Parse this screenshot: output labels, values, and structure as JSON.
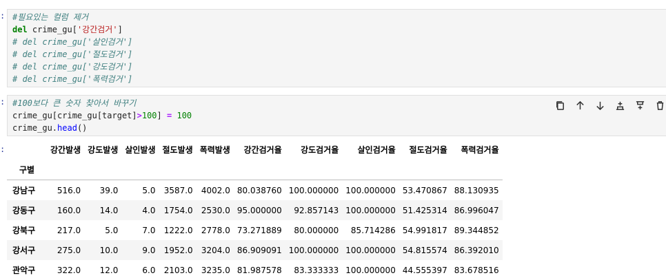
{
  "cell1": {
    "lines": [
      [
        {
          "t": "#필요있는 컬럼 제거",
          "c": "cm"
        }
      ],
      [
        {
          "t": "del",
          "c": "kw"
        },
        {
          "t": " crime_gu[",
          "c": ""
        },
        {
          "t": "'강간검거'",
          "c": "st"
        },
        {
          "t": "]",
          "c": ""
        }
      ],
      [
        {
          "t": "# del crime_gu['살인검거']",
          "c": "cm"
        }
      ],
      [
        {
          "t": "# del crime_gu['절도검거']",
          "c": "cm"
        }
      ],
      [
        {
          "t": "# del crime_gu['강도검거']",
          "c": "cm"
        }
      ],
      [
        {
          "t": "# del crime_gu['폭력검거']",
          "c": "cm"
        }
      ]
    ]
  },
  "cell2": {
    "lines": [
      [
        {
          "t": "#100보다 큰 숫자 찾아서 바꾸기",
          "c": "cm"
        }
      ],
      [
        {
          "t": "crime_gu[crime_gu[target]",
          "c": ""
        },
        {
          "t": ">",
          "c": "op"
        },
        {
          "t": "100",
          "c": "nu"
        },
        {
          "t": "] ",
          "c": ""
        },
        {
          "t": "=",
          "c": "op"
        },
        {
          "t": " ",
          "c": ""
        },
        {
          "t": "100",
          "c": "nu"
        }
      ],
      [
        {
          "t": "crime_gu.",
          "c": ""
        },
        {
          "t": "head",
          "c": "fn"
        },
        {
          "t": "()",
          "c": ""
        }
      ]
    ],
    "toolbar": [
      "copy-icon",
      "move-up-icon",
      "move-down-icon",
      "insert-above-icon",
      "insert-below-icon",
      "delete-icon"
    ]
  },
  "table": {
    "index_name": "구별",
    "columns": [
      "강간발생",
      "강도발생",
      "살인발생",
      "절도발생",
      "폭력발생",
      "강간검거율",
      "강도검거율",
      "살인검거율",
      "절도검거율",
      "폭력검거율"
    ],
    "rows": [
      {
        "index": "강남구",
        "values": [
          "516.0",
          "39.0",
          "5.0",
          "3587.0",
          "4002.0",
          "80.038760",
          "100.000000",
          "100.000000",
          "53.470867",
          "88.130935"
        ]
      },
      {
        "index": "강동구",
        "values": [
          "160.0",
          "14.0",
          "4.0",
          "1754.0",
          "2530.0",
          "95.000000",
          "92.857143",
          "100.000000",
          "51.425314",
          "86.996047"
        ]
      },
      {
        "index": "강북구",
        "values": [
          "217.0",
          "5.0",
          "7.0",
          "1222.0",
          "2778.0",
          "73.271889",
          "80.000000",
          "85.714286",
          "54.991817",
          "89.344852"
        ]
      },
      {
        "index": "강서구",
        "values": [
          "275.0",
          "10.0",
          "9.0",
          "1952.0",
          "3204.0",
          "86.909091",
          "100.000000",
          "100.000000",
          "54.815574",
          "86.392010"
        ]
      },
      {
        "index": "관악구",
        "values": [
          "322.0",
          "12.0",
          "6.0",
          "2103.0",
          "3235.0",
          "81.987578",
          "83.333333",
          "100.000000",
          "44.555397",
          "83.678516"
        ]
      }
    ]
  }
}
